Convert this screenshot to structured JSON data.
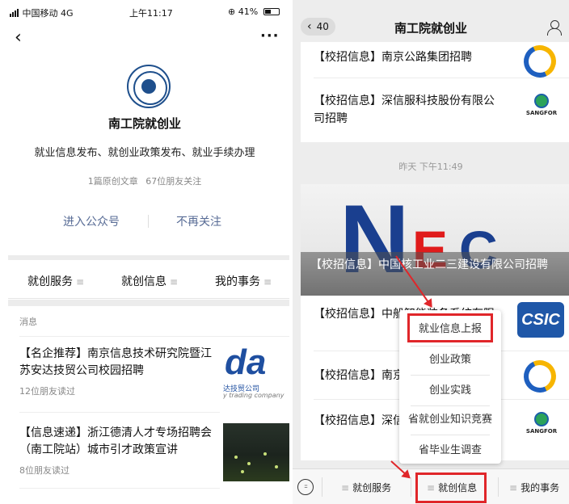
{
  "left": {
    "status": {
      "carrier": "中国移动",
      "network": "4G",
      "time": "上午11:17",
      "battery_text": "41%"
    },
    "account": {
      "name": "南工院就创业",
      "description": "就业信息发布、就创业政策发布、就业手续办理",
      "stat_articles": "1篇原创文章",
      "stat_followers": "67位朋友关注"
    },
    "actions": {
      "enter": "进入公众号",
      "unfollow": "不再关注"
    },
    "menu": [
      "就创服务",
      "就创信息",
      "我的事务"
    ],
    "messages_header": "消息",
    "articles": [
      {
        "title": "【名企推荐】南京信息技术研究院暨江苏安达技贸公司校园招聘",
        "reads": "12位朋友读过",
        "thumb_big": "da",
        "thumb_sub": "达技贸公司",
        "thumb_sub2": "y trading company"
      },
      {
        "title": "【信息速递】浙江德清人才专场招聘会（南工院站）城市引才政策宣讲",
        "reads": "8位朋友读过"
      }
    ]
  },
  "right": {
    "nav": {
      "back_count": "40",
      "title": "南工院就创业"
    },
    "top_card": [
      {
        "text": "【校招信息】南京公路集团招聘"
      },
      {
        "text": "【校招信息】深信服科技股份有限公司招聘",
        "logo_text": "SANGFOR"
      }
    ],
    "time_label": "昨天 下午11:49",
    "banner": {
      "logo_n": "N",
      "logo_e": "E",
      "logo_c": "C",
      "text": "【校招信息】中国核工业二三建设有限公司招聘"
    },
    "list": [
      {
        "text": "【校招信息】中船智能装备系统有限",
        "logo_text": "CSIC"
      },
      {
        "text": "【校招信息】南京"
      },
      {
        "text": "【校招信息】深信司招聘",
        "logo_text": "SANGFOR"
      }
    ],
    "popup": [
      "就业信息上报",
      "创业政策",
      "创业实践",
      "省就创业知识竞赛",
      "省毕业生调查"
    ],
    "bottom_menu": {
      "keyboard_icon": "keyboard-icon",
      "items": [
        "就创服务",
        "就创信息",
        "我的事务"
      ]
    },
    "accent": "#e0262a"
  }
}
